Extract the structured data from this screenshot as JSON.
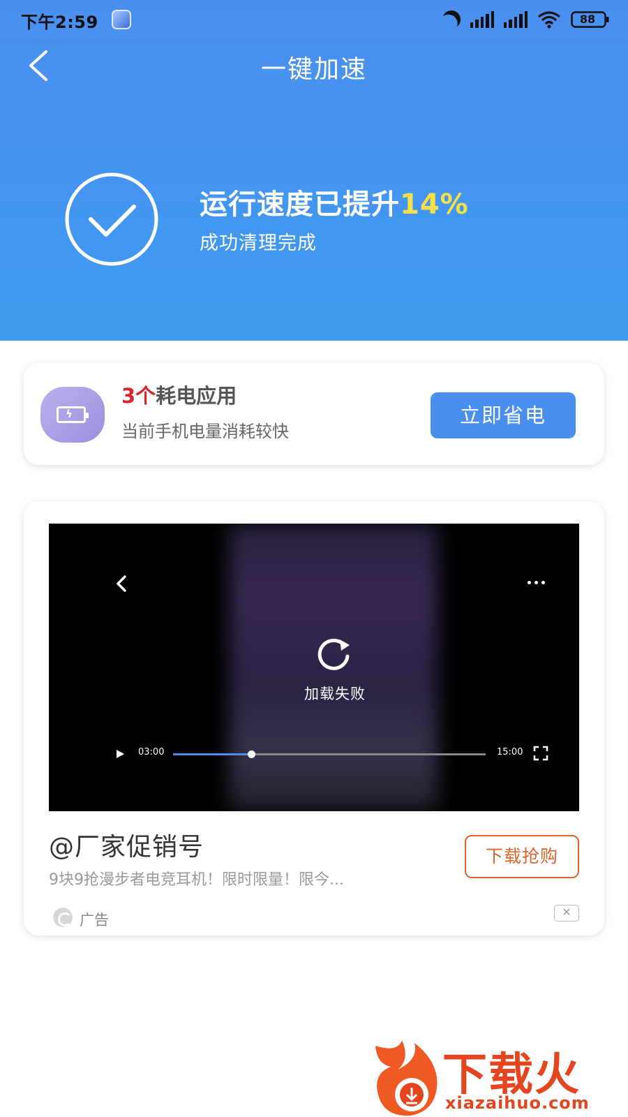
{
  "status_bar": {
    "time": "下午2:59",
    "battery": "88",
    "icons": [
      "app-notification-icon",
      "moon-icon",
      "signal-icon",
      "hd-signal-icon",
      "wifi-icon",
      "battery-icon"
    ]
  },
  "header": {
    "title": "一键加速",
    "back_icon": "back-arrow-icon",
    "background_color": "#4a8ff0"
  },
  "result": {
    "title_prefix": "运行速度已提升",
    "percent": "14%",
    "subtitle": "成功清理完成",
    "icon": "check-circle-icon",
    "highlight_color": "#f5e04a"
  },
  "battery_card": {
    "count": "3个",
    "title": "耗电应用",
    "description": "当前手机电量消耗较快",
    "button_label": "立即省电",
    "icon": "battery-app-icon"
  },
  "ad_card": {
    "video": {
      "status_text": "加载失败",
      "current_time": "03:00",
      "total_time": "15:00",
      "progress": 0.25
    },
    "title": "@厂家促销号",
    "description": "9块9抢漫步者电竞耳机！限时限量！限今...",
    "button_label": "下载抢购",
    "ad_label": "广告",
    "close_label": "✕"
  },
  "watermark": {
    "text": "下载火",
    "url": "xiazaihuo.com"
  }
}
